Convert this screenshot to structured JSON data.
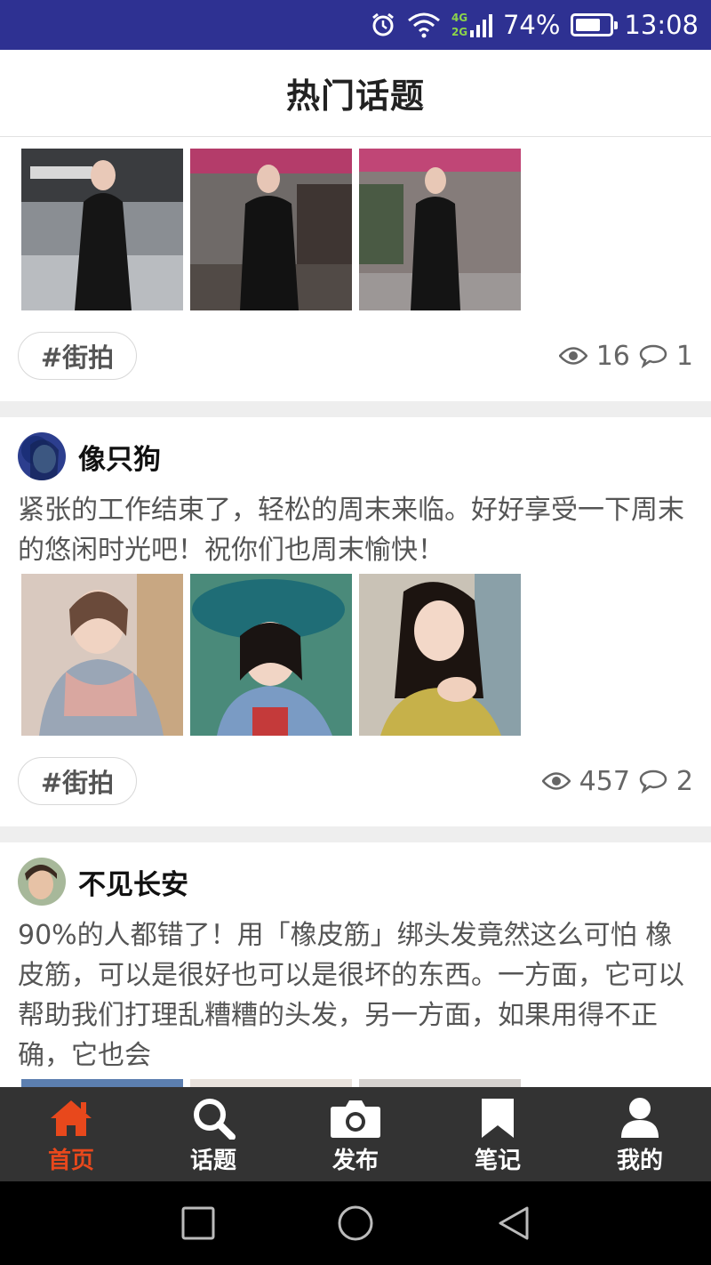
{
  "status_bar": {
    "network_top": "4G",
    "network_bottom": "2G",
    "battery": "74%",
    "battery_level": 0.74,
    "time": "13:08",
    "background": "#2e3192"
  },
  "header": {
    "title": "热门话题"
  },
  "posts": [
    {
      "user": "",
      "text": "",
      "tag": "#街拍",
      "views": "16",
      "comments": "1"
    },
    {
      "user": "像只狗",
      "text": "紧张的工作结束了，轻松的周末来临。好好享受一下周末的悠闲时光吧！祝你们也周末愉快！",
      "tag": "#街拍",
      "views": "457",
      "comments": "2"
    },
    {
      "user": "不见长安",
      "text": "90%的人都错了！用「橡皮筋」绑头发竟然这么可怕 橡皮筋，可以是很好也可以是很坏的东西。一方面，它可以帮助我们打理乱糟糟的头发，另一方面，如果用得不正确，它也会"
    }
  ],
  "tabbar": {
    "active_color": "#e8481c",
    "items": [
      {
        "label": "首页",
        "icon": "home-icon",
        "active": true
      },
      {
        "label": "话题",
        "icon": "search-icon",
        "active": false
      },
      {
        "label": "发布",
        "icon": "camera-icon",
        "active": false
      },
      {
        "label": "笔记",
        "icon": "bookmark-icon",
        "active": false
      },
      {
        "label": "我的",
        "icon": "user-icon",
        "active": false
      }
    ]
  }
}
